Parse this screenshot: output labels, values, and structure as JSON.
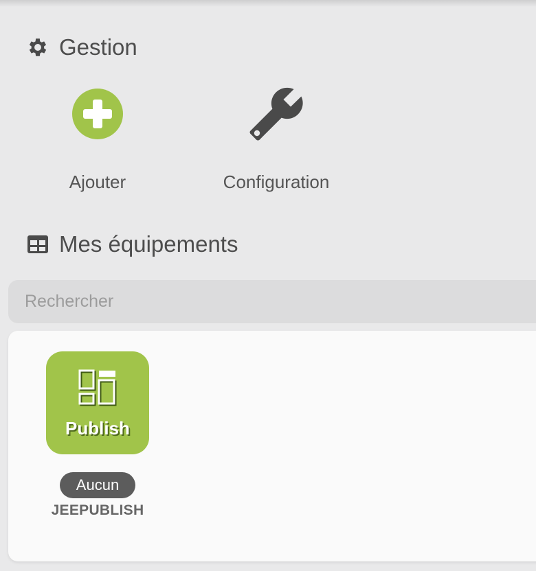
{
  "gestion": {
    "title": "Gestion",
    "add_label": "Ajouter",
    "config_label": "Configuration"
  },
  "equipements": {
    "title": "Mes équipements",
    "search_placeholder": "Rechercher",
    "items": [
      {
        "tile_text": "Publish",
        "badge": "Aucun",
        "name": "JEEPUBLISH"
      }
    ]
  },
  "colors": {
    "add_green": "#a1c44a",
    "tile_green": "#a1c44a",
    "icon_dark": "#4a4a4a",
    "badge_bg": "#5c5c5c"
  }
}
